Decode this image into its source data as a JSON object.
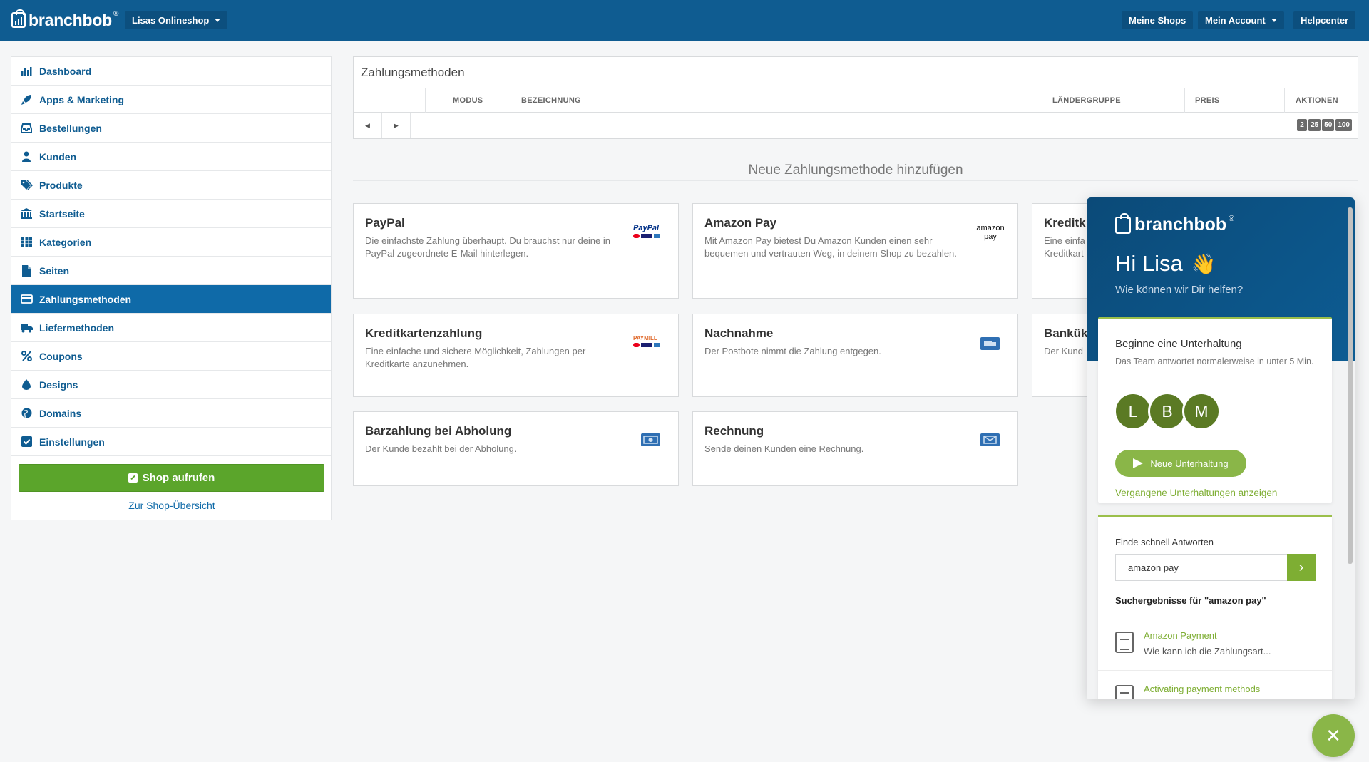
{
  "topbar": {
    "logo": "branchbob",
    "logo_reg": "®",
    "shop_selector": "Lisas Onlineshop",
    "nav": [
      "Meine Shops",
      "Mein Account",
      "Helpcenter"
    ]
  },
  "sidebar": {
    "items": [
      {
        "label": "Dashboard",
        "icon": "bar-chart-icon"
      },
      {
        "label": "Apps & Marketing",
        "icon": "rocket-icon"
      },
      {
        "label": "Bestellungen",
        "icon": "inbox-icon"
      },
      {
        "label": "Kunden",
        "icon": "user-icon"
      },
      {
        "label": "Produkte",
        "icon": "tags-icon"
      },
      {
        "label": "Startseite",
        "icon": "bank-icon"
      },
      {
        "label": "Kategorien",
        "icon": "grid-icon"
      },
      {
        "label": "Seiten",
        "icon": "file-icon"
      },
      {
        "label": "Zahlungsmethoden",
        "icon": "credit-card-icon",
        "active": true
      },
      {
        "label": "Liefermethoden",
        "icon": "truck-icon"
      },
      {
        "label": "Coupons",
        "icon": "percent-icon"
      },
      {
        "label": "Designs",
        "icon": "drop-icon"
      },
      {
        "label": "Domains",
        "icon": "globe-icon"
      },
      {
        "label": "Einstellungen",
        "icon": "check-square-icon"
      }
    ],
    "shop_button": "Shop aufrufen",
    "overview_link": "Zur Shop-Übersicht"
  },
  "table": {
    "title": "Zahlungsmethoden",
    "columns": [
      "MODUS",
      "BEZEICHNUNG",
      "LÄNDERGRUPPE",
      "PREIS",
      "AKTIONEN"
    ],
    "page_sizes": [
      "2",
      "25",
      "50",
      "100"
    ]
  },
  "add_section": {
    "title": "Neue Zahlungsmethode hinzufügen",
    "cards": [
      {
        "title": "PayPal",
        "desc": "Die einfachste Zahlung überhaupt. Du brauchst nur deine in PayPal zugeordnete E-Mail hinterlegen.",
        "logo": "PayPal"
      },
      {
        "title": "Amazon Pay",
        "desc": "Mit Amazon Pay bietest Du Amazon Kunden einen sehr bequemen und vertrauten Weg, in deinem Shop zu bezahlen.",
        "logo": "amazon pay"
      },
      {
        "title": "Kreditk",
        "desc": "Eine einfa Kreditkart"
      },
      {
        "title": "Kreditkartenzahlung",
        "desc": "Eine einfache und sichere Möglichkeit, Zahlungen per Kreditkarte anzunehmen.",
        "logo": "PAYMILL"
      },
      {
        "title": "Nachnahme",
        "desc": "Der Postbote nimmt die Zahlung entgegen."
      },
      {
        "title": "Bankük",
        "desc": "Der Kund"
      },
      {
        "title": "Barzahlung bei Abholung",
        "desc": "Der Kunde bezahlt bei der Abholung."
      },
      {
        "title": "Rechnung",
        "desc": "Sende deinen Kunden eine Rechnung."
      }
    ]
  },
  "chat": {
    "logo": "branchbob",
    "greeting": "Hi Lisa",
    "wave": "👋",
    "help": "Wie können wir Dir helfen?",
    "conversation_title": "Beginne eine Unterhaltung",
    "conversation_sub": "Das Team antwortet normalerweise in unter 5 Min.",
    "avatars": [
      "L",
      "B",
      "M"
    ],
    "new_button": "Neue Unterhaltung",
    "past_link": "Vergangene Unterhaltungen anzeigen",
    "search_title": "Finde schnell Antworten",
    "search_value": "amazon pay",
    "results_label": "Suchergebnisse für \"amazon pay\"",
    "results": [
      {
        "title": "Amazon Payment",
        "snippet": "Wie kann ich die Zahlungsart..."
      },
      {
        "title": "Activating payment methods",
        "snippet": ""
      }
    ],
    "close": "✕"
  }
}
